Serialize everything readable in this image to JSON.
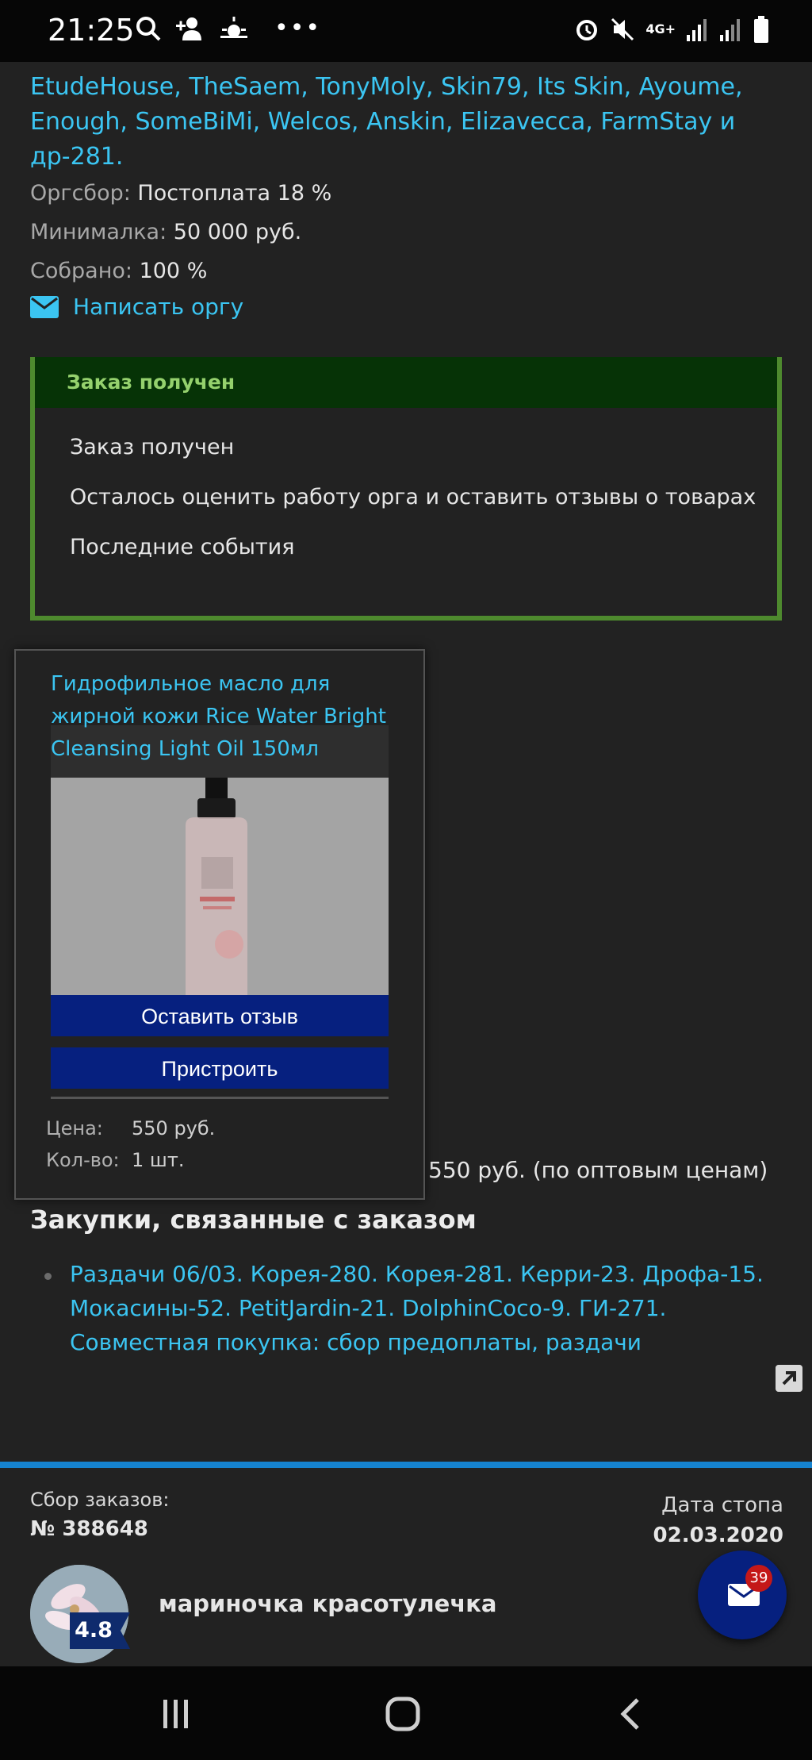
{
  "status_bar": {
    "time": "21:25",
    "network": "4G+",
    "icons_left": [
      "search-icon",
      "person-add-icon",
      "weather-icon",
      "more-dots-icon"
    ],
    "icons_right": [
      "alarm-icon",
      "mute-icon",
      "network-4g-icon",
      "signal-icon",
      "signal-icon",
      "battery-icon"
    ]
  },
  "purchase": {
    "brands_text": "EtudeHouse, TheSaem, TonyMoly, Skin79, Its Skin, Ayoume, Enough, SomeBiMi, Welcos, Anskin, Elizavecca, FarmStay и др-281.",
    "fee_label": "Оргсбор:",
    "fee_value": "Постоплата 18 %",
    "min_label": "Минималка:",
    "min_value": "50 000 руб.",
    "collected_label": "Собрано:",
    "collected_value": "100 %",
    "write_org": "Написать оргу"
  },
  "order_status": {
    "header": "Заказ получен",
    "line1": "Заказ получен",
    "line2": "Осталось оценить работу орга и оставить отзывы о товарах",
    "events_link": "Последние события"
  },
  "product_popup": {
    "title": "Гидрофильное масло для жирной кожи Rice Water Bright Cleansing Light Oil 150мл",
    "review_button": "Оставить отзыв",
    "attach_button": "Пристроить",
    "price_label": "Цена:",
    "price_value": "550 руб.",
    "qty_label": "Кол-во:",
    "qty_value": "1 шт."
  },
  "order_total_partial": "550 руб. (по оптовым ценам)",
  "related": {
    "title": "Закупки, связанные с заказом",
    "items": [
      "Раздачи 06/03. Корея-280. Корея-281. Керри-23. Дрофа-15. Мокасины-52. PetitJardin-21. DolphinCoco-9. ГИ-271. Совместная покупка: сбор предоплаты, раздачи"
    ]
  },
  "footer": {
    "collect_label": "Сбор заказов:",
    "order_number": "№ 388648",
    "stop_label": "Дата стопа",
    "stop_date": "02.03.2020",
    "username": "мариночка красотулечка",
    "rating": "4.8",
    "messages_count": "39"
  },
  "colors": {
    "background": "#222222",
    "link": "#3bc5f2",
    "accent_blue": "#06207f",
    "status_green": "#4e8a2e",
    "divider_blue": "#1683cf",
    "badge_red": "#c41818"
  }
}
